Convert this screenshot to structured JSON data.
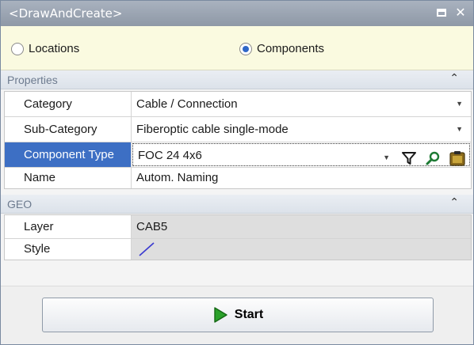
{
  "window": {
    "title": "<DrawAndCreate>"
  },
  "mode": {
    "locations_label": "Locations",
    "components_label": "Components",
    "selected": "Components"
  },
  "properties": {
    "header": "Properties",
    "rows": [
      {
        "label": "Category",
        "value": "Cable / Connection"
      },
      {
        "label": "Sub-Category",
        "value": "Fiberoptic cable single-mode"
      },
      {
        "label": "Component Type",
        "value": "FOC 24 4x6"
      },
      {
        "label": "Name",
        "value": "Autom. Naming"
      }
    ]
  },
  "geo": {
    "header": "GEO",
    "rows": [
      {
        "label": "Layer",
        "value": "CAB5"
      },
      {
        "label": "Style",
        "value": ""
      }
    ]
  },
  "footer": {
    "start_label": "Start"
  },
  "colors": {
    "selection": "#3d6fc4",
    "start_icon": "#2aa12a",
    "style_line": "#3a3ad0"
  }
}
